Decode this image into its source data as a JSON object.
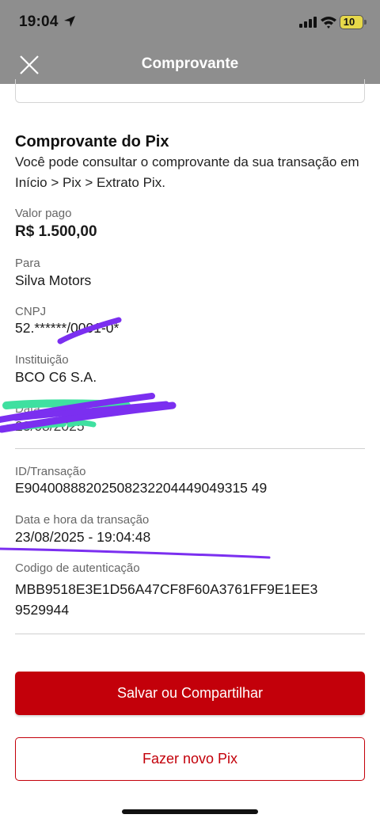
{
  "status_bar": {
    "time": "19:04",
    "battery": "10"
  },
  "nav": {
    "title": "Comprovante"
  },
  "receipt": {
    "title": "Comprovante do Pix",
    "description": "Você pode consultar o comprovante da sua transação em Início > Pix > Extrato Pix."
  },
  "fields": {
    "amount_label": "Valor pago",
    "amount_value": "R$ 1.500,00",
    "to_label": "Para",
    "to_value": "Silva Motors",
    "cnpj_label": "CNPJ",
    "cnpj_value": "52.******/0001-0*",
    "institution_label": "Instituição",
    "institution_value": "BCO C6 S.A.",
    "redacted_label": "Data",
    "redacted_value": "23/08/2025",
    "transaction_id_label": "ID/Transação",
    "transaction_id_value": "E90400888202508232204449049315 49",
    "datetime_label": "Data e hora da transação",
    "datetime_value": "23/08/2025 - 19:04:48",
    "auth_code_label": "Codigo de autenticação",
    "auth_code_line1": "MBB9518E3E1D56A47CF8F60A3761FF9E1EE3",
    "auth_code_line2": "9529944"
  },
  "actions": {
    "save_share_label": "Salvar ou Compartilhar",
    "new_pix_label": "Fazer novo Pix"
  },
  "colors": {
    "brand_red": "#c3000a",
    "header_gray": "#8e8e8e",
    "scribble_purple": "#7b2ff0",
    "scribble_green": "#3fe0a0"
  }
}
